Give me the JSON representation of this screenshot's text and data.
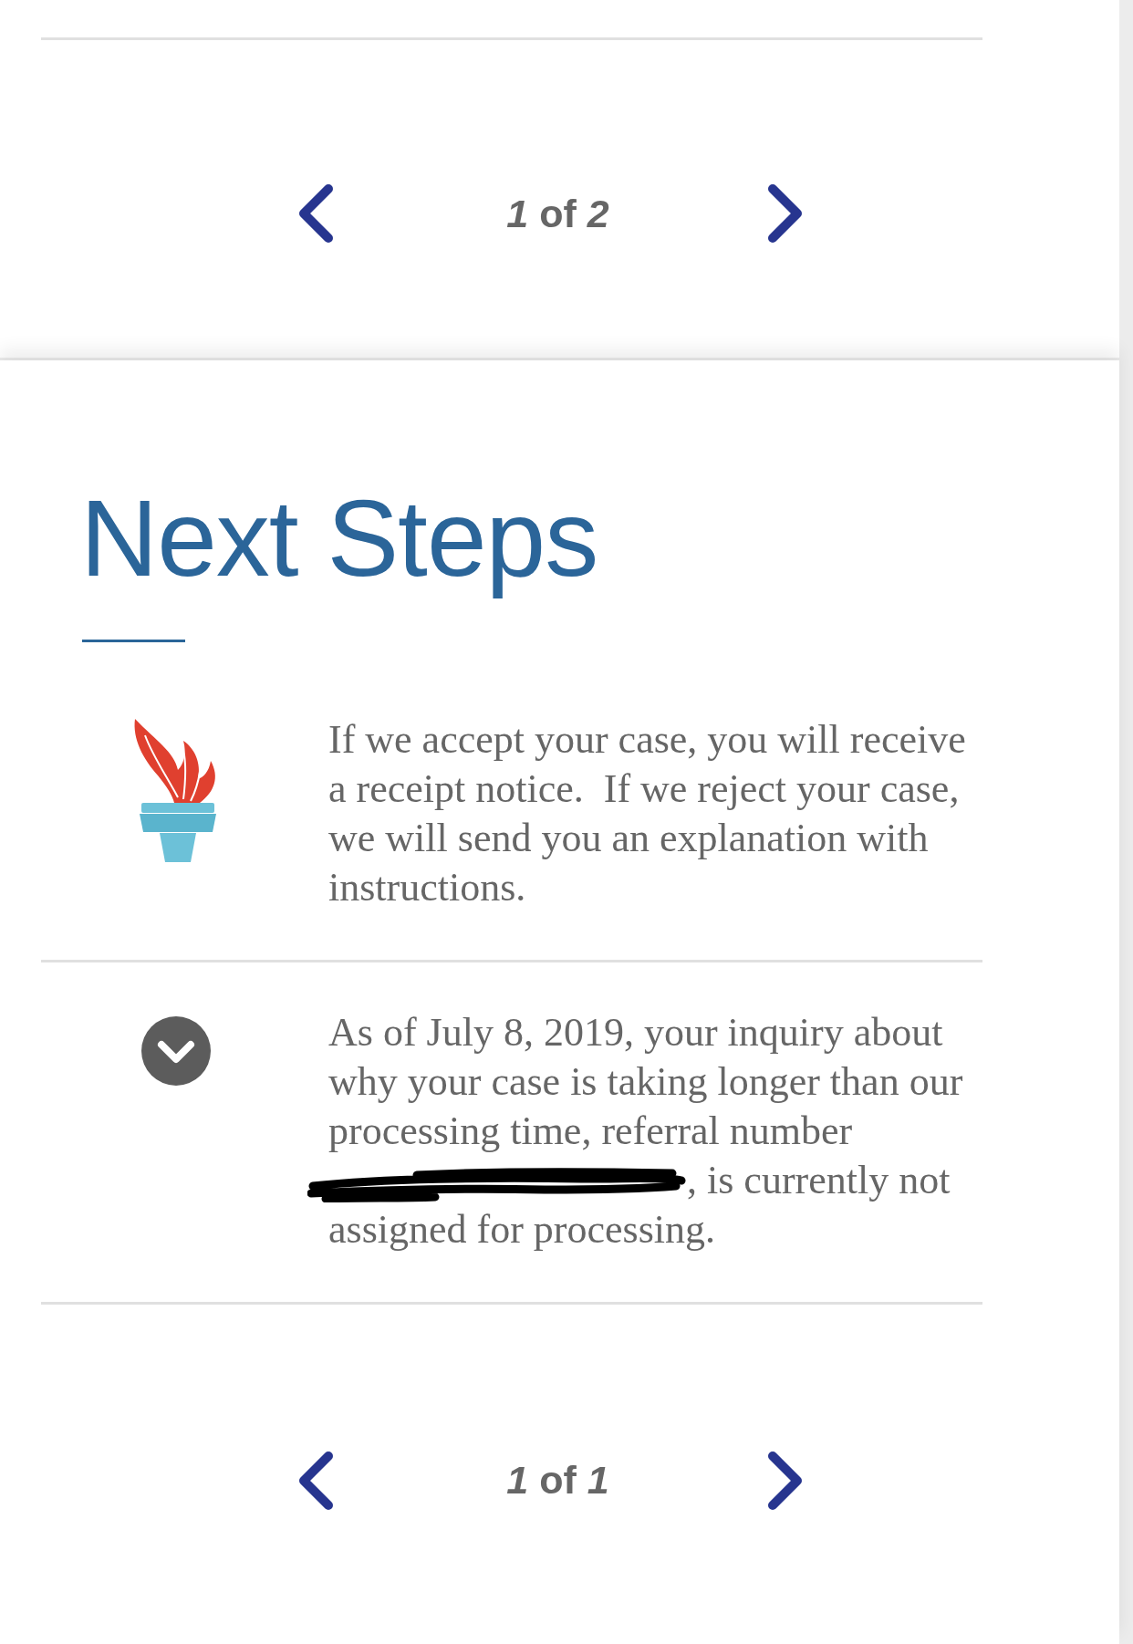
{
  "case_card": {
    "pager": {
      "label": "*1* of *2*"
    }
  },
  "next_steps": {
    "title": "Next Steps",
    "items": [
      {
        "kind": "torch",
        "text": "If we accept your case, you will receive a receipt notice.  If we reject your case, we will send you an explanation with instructions."
      },
      {
        "kind": "chevron",
        "text": "As of July 8, 2019, your inquiry about why your case is taking longer than our processing time, referral number",
        "redacted": true,
        "text_after": ", is currently not",
        "text_continued": "assigned for processing."
      }
    ],
    "pager": {
      "label": "*1* of *1*"
    }
  }
}
